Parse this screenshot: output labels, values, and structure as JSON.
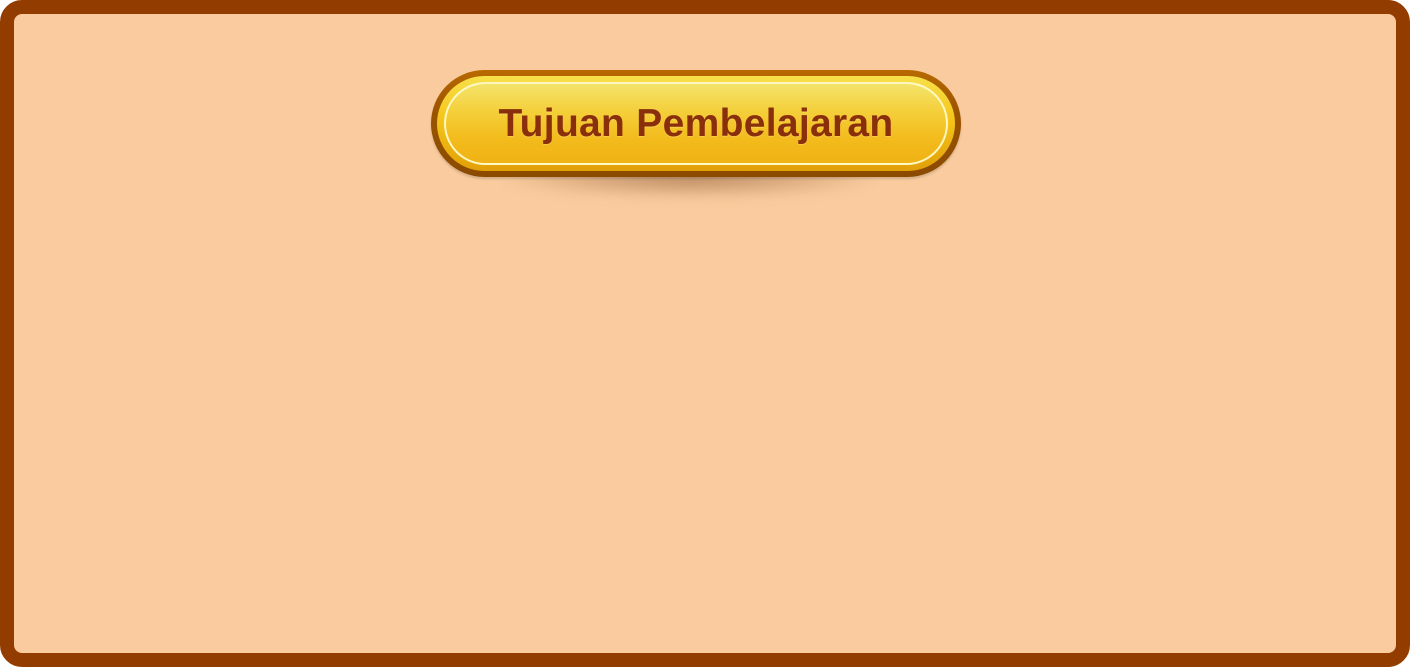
{
  "slide": {
    "title": "Tujuan Pembelajaran"
  },
  "colors": {
    "frame_border": "#933c00",
    "background": "#f9cb9e",
    "pill_outer": "#9a5400",
    "pill_fill_top": "#f3e36a",
    "pill_fill_bottom": "#f0b214",
    "title_text": "#8a2f0c"
  }
}
